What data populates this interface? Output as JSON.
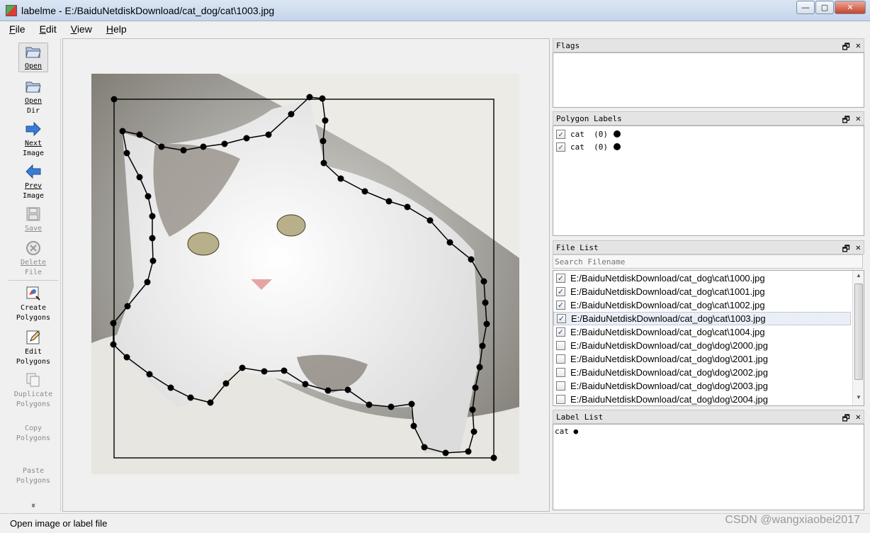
{
  "window": {
    "title": "labelme - E:/BaiduNetdiskDownload/cat_dog/cat\\1003.jpg",
    "minimize": "—",
    "maximize": "▢",
    "close": "✕"
  },
  "menu": [
    {
      "key": "F",
      "rest": "ile"
    },
    {
      "key": "E",
      "rest": "dit"
    },
    {
      "key": "V",
      "rest": "iew"
    },
    {
      "key": "H",
      "rest": "elp"
    }
  ],
  "toolbar": {
    "open": [
      "Open"
    ],
    "open_dir": [
      "Open",
      "Dir"
    ],
    "next_image": [
      "Next",
      "Image"
    ],
    "prev_image": [
      "Prev",
      "Image"
    ],
    "save": [
      "Save"
    ],
    "delete_file": [
      "Delete",
      "File"
    ],
    "create_polygons": [
      "Create",
      "Polygons"
    ],
    "edit_polygons": [
      "Edit",
      "Polygons"
    ],
    "duplicate_polygons": [
      "Duplicate",
      "Polygons"
    ],
    "copy_polygons": [
      "Copy",
      "Polygons"
    ],
    "paste_polygons": [
      "Paste",
      "Polygons"
    ],
    "more": "»"
  },
  "docks": {
    "flags_title": "Flags",
    "polygon_labels_title": "Polygon Labels",
    "file_list_title": "File List",
    "label_list_title": "Label List",
    "restore_icon": "🗗",
    "close_icon": "✕"
  },
  "polygon_labels": [
    {
      "label": "cat",
      "group": "(0)",
      "checked": true
    },
    {
      "label": "cat",
      "group": "(0)",
      "checked": true
    }
  ],
  "file_search": {
    "placeholder": "Search Filename"
  },
  "files": [
    {
      "path": "E:/BaiduNetdiskDownload/cat_dog\\cat\\1000.jpg",
      "checked": true
    },
    {
      "path": "E:/BaiduNetdiskDownload/cat_dog\\cat\\1001.jpg",
      "checked": true
    },
    {
      "path": "E:/BaiduNetdiskDownload/cat_dog\\cat\\1002.jpg",
      "checked": true
    },
    {
      "path": "E:/BaiduNetdiskDownload/cat_dog\\cat\\1003.jpg",
      "checked": true,
      "selected": true
    },
    {
      "path": "E:/BaiduNetdiskDownload/cat_dog\\cat\\1004.jpg",
      "checked": true
    },
    {
      "path": "E:/BaiduNetdiskDownload/cat_dog\\dog\\2000.jpg",
      "checked": false
    },
    {
      "path": "E:/BaiduNetdiskDownload/cat_dog\\dog\\2001.jpg",
      "checked": false
    },
    {
      "path": "E:/BaiduNetdiskDownload/cat_dog\\dog\\2002.jpg",
      "checked": false
    },
    {
      "path": "E:/BaiduNetdiskDownload/cat_dog\\dog\\2003.jpg",
      "checked": false
    },
    {
      "path": "E:/BaiduNetdiskDownload/cat_dog\\dog\\2004.jpg",
      "checked": false
    }
  ],
  "label_list": [
    {
      "label": "cat",
      "marker": "●"
    }
  ],
  "status": {
    "message": "Open image or label file"
  },
  "watermark": "CSDN @wangxiaobei2017",
  "colors": {
    "accent_check": "#2a4a8a",
    "polygon_vertex": "#000000",
    "arrow_blue": "#3b7bd6"
  },
  "icons": {
    "open": "folder-open-icon",
    "open_dir": "folder-open-icon",
    "next": "arrow-right-icon",
    "prev": "arrow-left-icon",
    "save": "floppy-disk-icon",
    "delete": "close-circle-icon",
    "create": "polygon-create-icon",
    "edit": "pencil-edit-icon",
    "duplicate": "copy-icon"
  }
}
